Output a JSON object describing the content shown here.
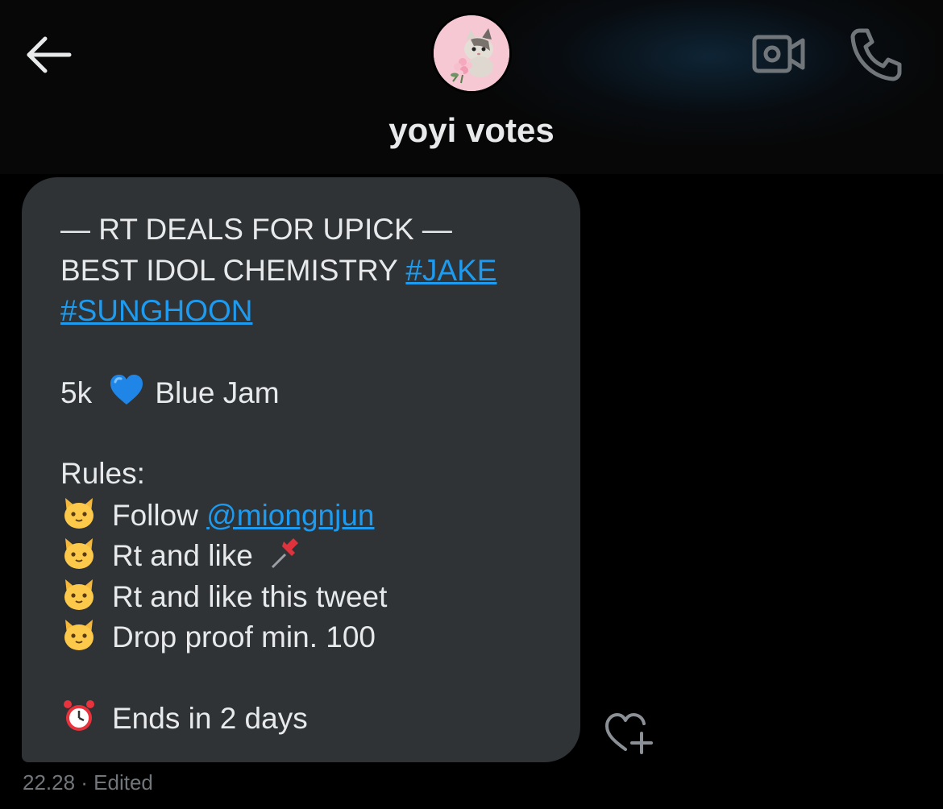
{
  "header": {
    "title": "yoyi votes",
    "back_icon": "arrow-left-icon",
    "video_icon": "video-camera-icon",
    "call_icon": "phone-icon",
    "avatar_icon": "cat-with-flowers-avatar"
  },
  "message": {
    "lines": {
      "l1": "— RT DEALS FOR UPICK —",
      "l2_text": "BEST IDOL CHEMISTRY ",
      "l2_tag": "#JAKE",
      "l3_tag": "#SUNGHOON",
      "l4_amount": "5k",
      "l4_label": "Blue Jam",
      "rules_title": "Rules:",
      "rule1_text": "Follow ",
      "rule1_mention": "@miongnjun",
      "rule2": "Rt and like",
      "rule3": "Rt and like this tweet",
      "rule4": "Drop proof min. 100",
      "ends": "Ends in 2 days"
    },
    "emojis": {
      "heart": "blue-heart-icon",
      "rule_bullet": "cat-face-icon",
      "pin": "pushpin-icon",
      "clock": "alarm-clock-icon"
    },
    "timestamp": "22.28 · Edited"
  },
  "colors": {
    "background": "#000000",
    "bubble": "#2f3336",
    "link": "#1d9bf0",
    "muted": "#71767b",
    "text": "#e7e9ea"
  }
}
